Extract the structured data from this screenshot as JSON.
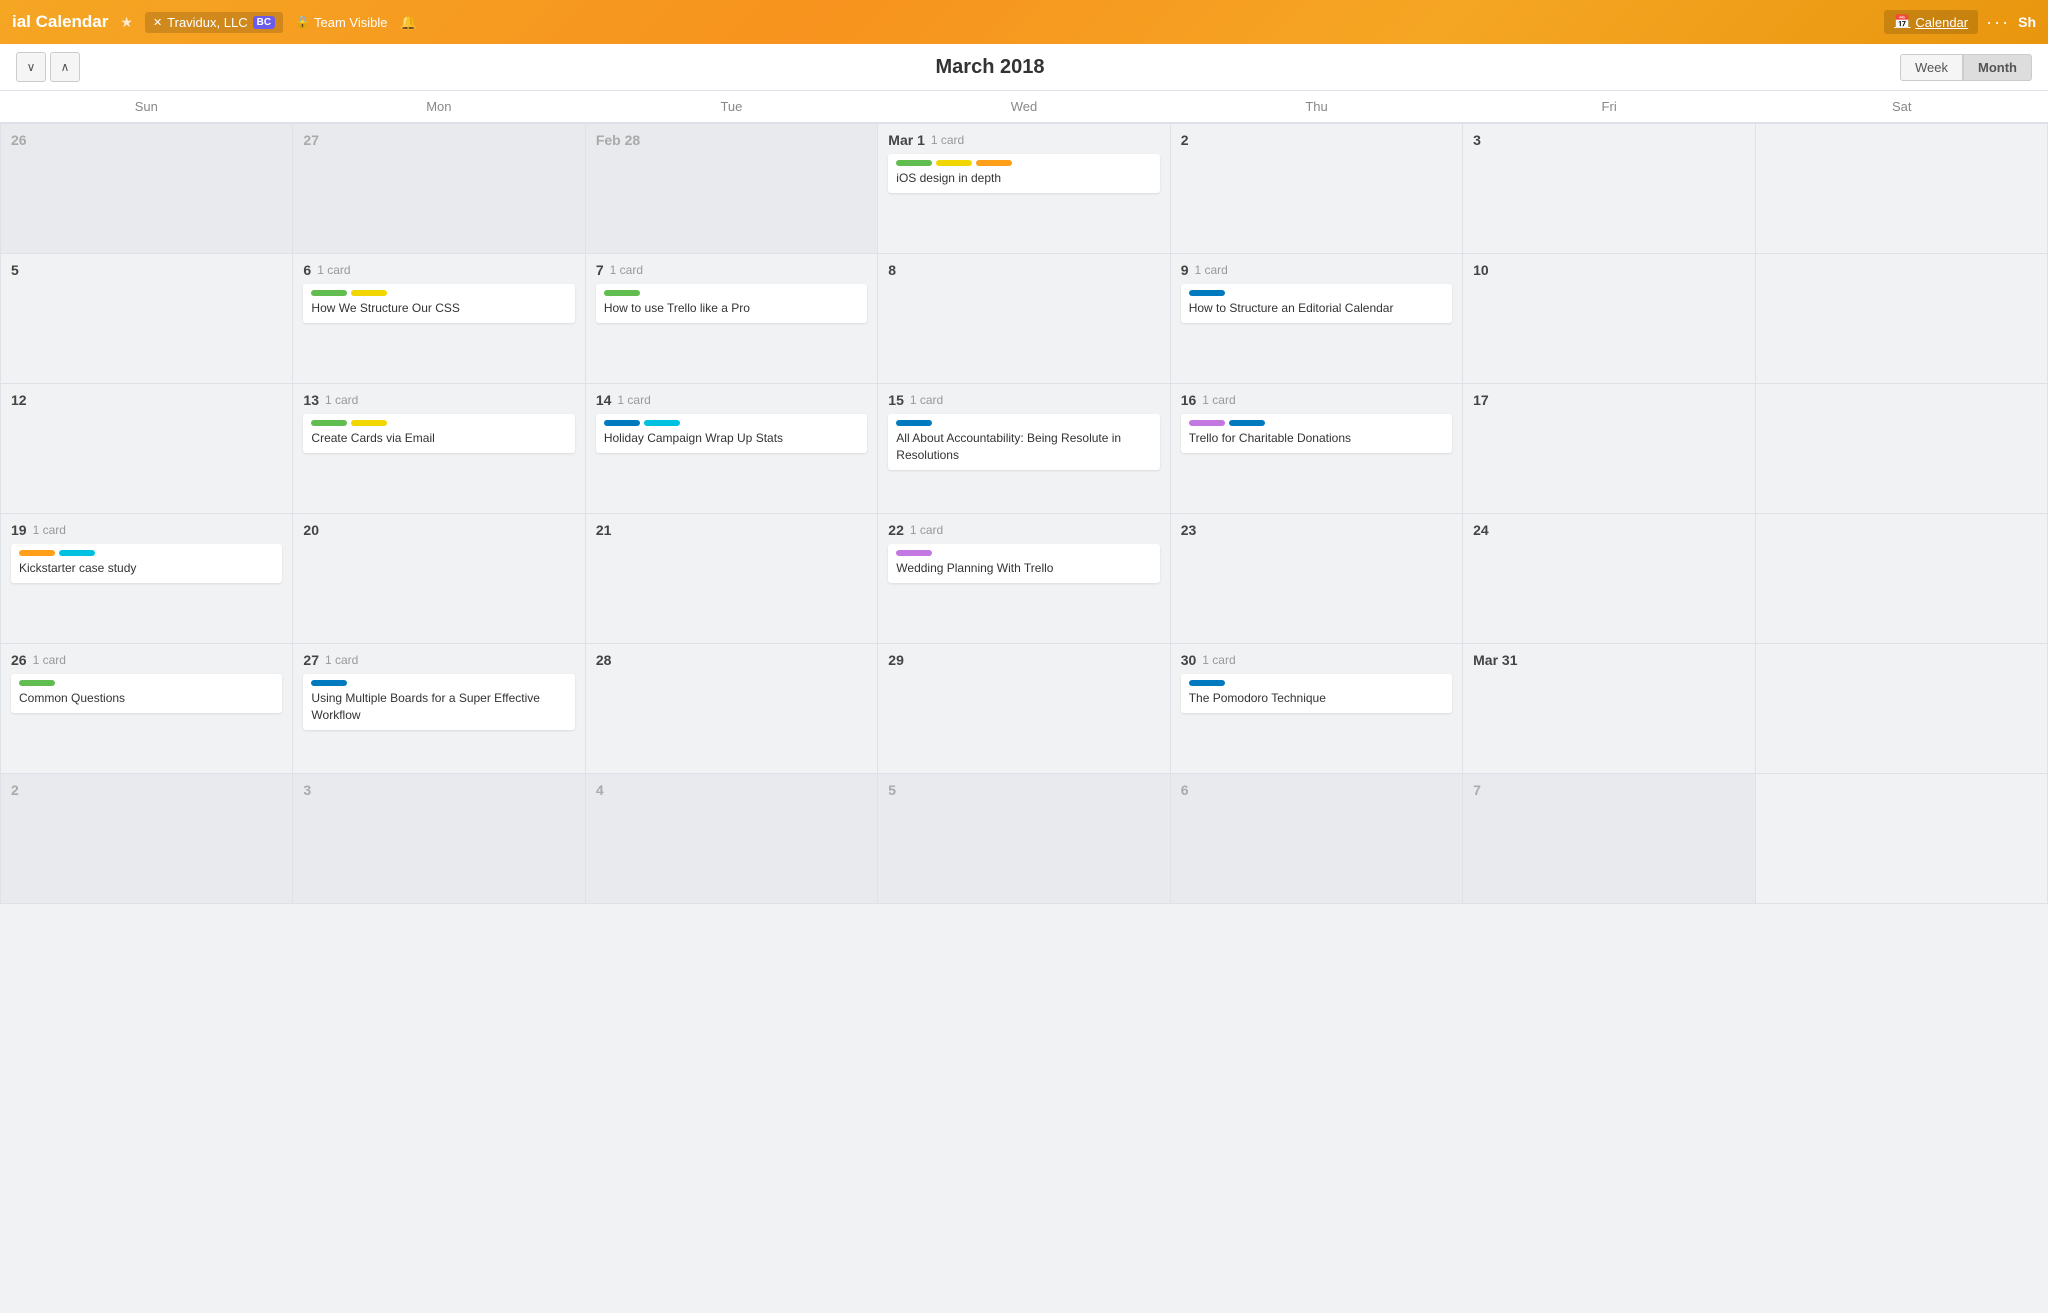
{
  "topbar": {
    "title": "ial Calendar",
    "star_label": "★",
    "org_name": "Travidux, LLC",
    "bc_badge": "BC",
    "team_visible": "Team Visible",
    "calendar_btn": "Calendar",
    "more_btn": "···",
    "share_btn": "Sh"
  },
  "calendar_nav": {
    "title": "March 2018",
    "week_btn": "Week",
    "month_btn": "Month"
  },
  "days_of_week": [
    "Sun",
    "Mon",
    "Tue",
    "Wed",
    "Thu",
    "Fri",
    "Sat"
  ],
  "weeks": [
    {
      "days": [
        {
          "num": "26",
          "type": "other",
          "cards": []
        },
        {
          "num": "27",
          "type": "other",
          "cards": []
        },
        {
          "num": "Feb 28",
          "type": "other",
          "cards": []
        },
        {
          "num": "Mar 1",
          "type": "current",
          "card_count": "1 card",
          "cards": [
            {
              "labels": [
                "green",
                "yellow",
                "orange"
              ],
              "title": "iOS design in depth"
            }
          ]
        },
        {
          "num": "2",
          "type": "current",
          "cards": []
        },
        {
          "num": "3",
          "type": "current",
          "cards": []
        },
        {
          "num": "",
          "type": "empty",
          "cards": []
        }
      ]
    },
    {
      "days": [
        {
          "num": "5",
          "type": "current",
          "cards": []
        },
        {
          "num": "6",
          "type": "current",
          "card_count": "1 card",
          "cards": [
            {
              "labels": [
                "green",
                "yellow"
              ],
              "title": "How We Structure Our CSS"
            }
          ]
        },
        {
          "num": "7",
          "type": "current",
          "card_count": "1 card",
          "cards": [
            {
              "labels": [
                "green"
              ],
              "title": "How to use Trello like a Pro"
            }
          ]
        },
        {
          "num": "8",
          "type": "current",
          "cards": []
        },
        {
          "num": "9",
          "type": "current",
          "card_count": "1 card",
          "cards": [
            {
              "labels": [
                "blue"
              ],
              "title": "How to Structure an Editorial Calendar"
            }
          ]
        },
        {
          "num": "10",
          "type": "current",
          "cards": []
        },
        {
          "num": "",
          "type": "empty",
          "cards": []
        }
      ]
    },
    {
      "days": [
        {
          "num": "12",
          "type": "current",
          "cards": []
        },
        {
          "num": "13",
          "type": "current",
          "card_count": "1 card",
          "cards": [
            {
              "labels": [
                "green",
                "yellow"
              ],
              "title": "Create Cards via Email"
            }
          ]
        },
        {
          "num": "14",
          "type": "current",
          "card_count": "1 card",
          "cards": [
            {
              "labels": [
                "blue",
                "cyan"
              ],
              "title": "Holiday Campaign Wrap Up Stats"
            }
          ]
        },
        {
          "num": "15",
          "type": "current",
          "card_count": "1 card",
          "cards": [
            {
              "labels": [
                "blue"
              ],
              "title": "All About Accountability: Being Resolute in Resolutions"
            }
          ]
        },
        {
          "num": "16",
          "type": "current",
          "card_count": "1 card",
          "cards": [
            {
              "labels": [
                "purple",
                "blue"
              ],
              "title": "Trello for Charitable Donations"
            }
          ]
        },
        {
          "num": "17",
          "type": "current",
          "cards": []
        },
        {
          "num": "",
          "type": "empty",
          "cards": []
        }
      ]
    },
    {
      "days": [
        {
          "num": "19",
          "type": "current",
          "card_count": "1 card",
          "cards": [
            {
              "labels": [
                "orange",
                "cyan"
              ],
              "title": "Kickstarter case study"
            }
          ]
        },
        {
          "num": "20",
          "type": "current",
          "cards": []
        },
        {
          "num": "21",
          "type": "current",
          "cards": []
        },
        {
          "num": "22",
          "type": "current",
          "card_count": "1 card",
          "cards": [
            {
              "labels": [
                "purple"
              ],
              "title": "Wedding Planning With Trello"
            }
          ]
        },
        {
          "num": "23",
          "type": "current",
          "cards": []
        },
        {
          "num": "24",
          "type": "current",
          "cards": []
        },
        {
          "num": "",
          "type": "empty",
          "cards": []
        }
      ]
    },
    {
      "days": [
        {
          "num": "26",
          "type": "current",
          "card_count": "1 card",
          "cards": [
            {
              "labels": [
                "green"
              ],
              "title": "Common Questions"
            }
          ]
        },
        {
          "num": "27",
          "type": "current",
          "card_count": "1 card",
          "cards": [
            {
              "labels": [
                "blue"
              ],
              "title": "Using Multiple Boards for a Super Effective Workflow"
            }
          ]
        },
        {
          "num": "28",
          "type": "current",
          "cards": []
        },
        {
          "num": "29",
          "type": "current",
          "cards": []
        },
        {
          "num": "30",
          "type": "current",
          "card_count": "1 card",
          "cards": [
            {
              "labels": [
                "blue"
              ],
              "title": "The Pomodoro Technique"
            }
          ]
        },
        {
          "num": "Mar 31",
          "type": "current",
          "cards": []
        },
        {
          "num": "",
          "type": "empty",
          "cards": []
        }
      ]
    },
    {
      "days": [
        {
          "num": "2",
          "type": "other",
          "cards": []
        },
        {
          "num": "3",
          "type": "other",
          "cards": []
        },
        {
          "num": "4",
          "type": "other",
          "cards": []
        },
        {
          "num": "5",
          "type": "other",
          "cards": []
        },
        {
          "num": "6",
          "type": "other",
          "cards": []
        },
        {
          "num": "7",
          "type": "other",
          "cards": []
        },
        {
          "num": "",
          "type": "empty",
          "cards": []
        }
      ]
    }
  ]
}
